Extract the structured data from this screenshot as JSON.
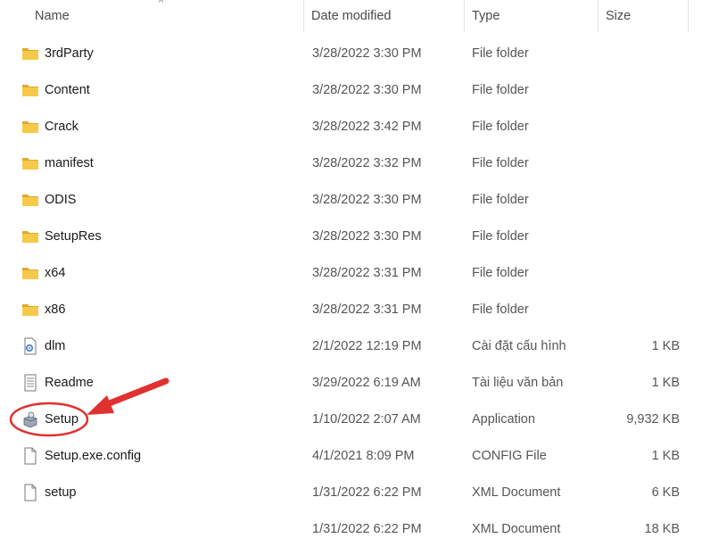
{
  "columns": {
    "name": "Name",
    "date_modified": "Date modified",
    "type": "Type",
    "size": "Size",
    "sort_indicator": "^"
  },
  "files": [
    {
      "name": "3rdParty",
      "date": "3/28/2022 3:30 PM",
      "type": "File folder",
      "size": "",
      "icon": "folder-icon"
    },
    {
      "name": "Content",
      "date": "3/28/2022 3:30 PM",
      "type": "File folder",
      "size": "",
      "icon": "folder-icon"
    },
    {
      "name": "Crack",
      "date": "3/28/2022 3:42 PM",
      "type": "File folder",
      "size": "",
      "icon": "folder-icon"
    },
    {
      "name": "manifest",
      "date": "3/28/2022 3:32 PM",
      "type": "File folder",
      "size": "",
      "icon": "folder-icon"
    },
    {
      "name": "ODIS",
      "date": "3/28/2022 3:30 PM",
      "type": "File folder",
      "size": "",
      "icon": "folder-icon"
    },
    {
      "name": "SetupRes",
      "date": "3/28/2022 3:30 PM",
      "type": "File folder",
      "size": "",
      "icon": "folder-icon"
    },
    {
      "name": "x64",
      "date": "3/28/2022 3:31 PM",
      "type": "File folder",
      "size": "",
      "icon": "folder-icon"
    },
    {
      "name": "x86",
      "date": "3/28/2022 3:31 PM",
      "type": "File folder",
      "size": "",
      "icon": "folder-icon"
    },
    {
      "name": "dlm",
      "date": "2/1/2022 12:19 PM",
      "type": "Cài đặt cấu hình",
      "size": "1 KB",
      "icon": "config-file-icon"
    },
    {
      "name": "Readme",
      "date": "3/29/2022 6:19 AM",
      "type": "Tài liệu văn bản",
      "size": "1 KB",
      "icon": "text-document-icon"
    },
    {
      "name": "Setup",
      "date": "1/10/2022 2:07 AM",
      "type": "Application",
      "size": "9,932 KB",
      "icon": "installer-app-icon",
      "highlighted": true
    },
    {
      "name": "Setup.exe.config",
      "date": "4/1/2021 8:09 PM",
      "type": "CONFIG File",
      "size": "1 KB",
      "icon": "blank-file-icon"
    },
    {
      "name": "setup",
      "date": "1/31/2022 6:22 PM",
      "type": "XML Document",
      "size": "6 KB",
      "icon": "blank-file-icon"
    },
    {
      "name": "",
      "date": "1/31/2022 6:22 PM",
      "type": "XML Document",
      "size": "18 KB",
      "icon": ""
    }
  ],
  "colors": {
    "annotation_red": "#e03131",
    "folder_yellow": "#f7c948",
    "folder_dark": "#e0a82e",
    "header_text": "#4a4a4a"
  }
}
